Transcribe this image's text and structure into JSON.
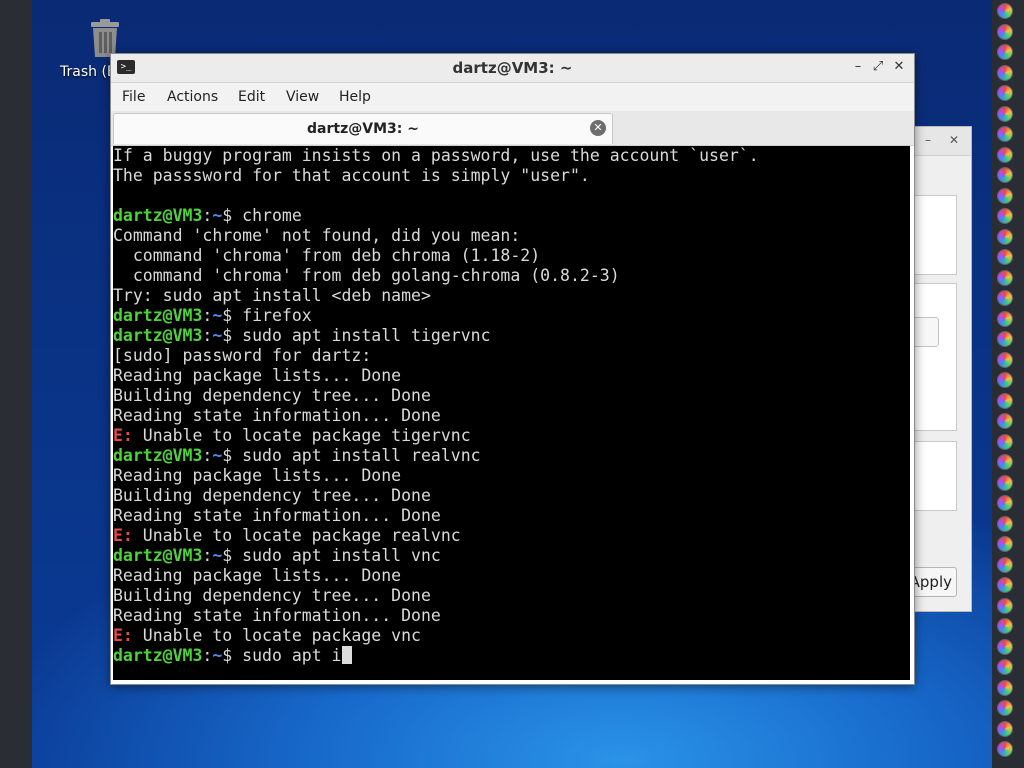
{
  "desktop": {
    "trash_label": "Trash (E"
  },
  "back_window": {
    "apply_label": "Apply"
  },
  "terminal_window": {
    "title": "dartz@VM3: ~",
    "menu": [
      "File",
      "Actions",
      "Edit",
      "View",
      "Help"
    ],
    "tab_label": "dartz@VM3: ~",
    "prompt_user": "dartz@VM3",
    "prompt_sep": ":",
    "prompt_path": "~",
    "prompt_symbol": "$ ",
    "lines": [
      {
        "type": "out",
        "text": "If a buggy program insists on a password, use the account `user`."
      },
      {
        "type": "out",
        "text": "The passsword for that account is simply \"user\"."
      },
      {
        "type": "out",
        "text": ""
      },
      {
        "type": "cmd",
        "text": "chrome"
      },
      {
        "type": "out",
        "text": "Command 'chrome' not found, did you mean:"
      },
      {
        "type": "out",
        "text": "  command 'chroma' from deb chroma (1.18-2)"
      },
      {
        "type": "out",
        "text": "  command 'chroma' from deb golang-chroma (0.8.2-3)"
      },
      {
        "type": "out",
        "text": "Try: sudo apt install <deb name>"
      },
      {
        "type": "cmd",
        "text": "firefox"
      },
      {
        "type": "cmd",
        "text": "sudo apt install tigervnc"
      },
      {
        "type": "out",
        "text": "[sudo] password for dartz:"
      },
      {
        "type": "out",
        "text": "Reading package lists... Done"
      },
      {
        "type": "out",
        "text": "Building dependency tree... Done"
      },
      {
        "type": "out",
        "text": "Reading state information... Done"
      },
      {
        "type": "err",
        "label": "E:",
        "text": " Unable to locate package tigervnc"
      },
      {
        "type": "cmd",
        "text": "sudo apt install realvnc"
      },
      {
        "type": "out",
        "text": "Reading package lists... Done"
      },
      {
        "type": "out",
        "text": "Building dependency tree... Done"
      },
      {
        "type": "out",
        "text": "Reading state information... Done"
      },
      {
        "type": "err",
        "label": "E:",
        "text": " Unable to locate package realvnc"
      },
      {
        "type": "cmd",
        "text": "sudo apt install vnc"
      },
      {
        "type": "out",
        "text": "Reading package lists... Done"
      },
      {
        "type": "out",
        "text": "Building dependency tree... Done"
      },
      {
        "type": "out",
        "text": "Reading state information... Done"
      },
      {
        "type": "err",
        "label": "E:",
        "text": " Unable to locate package vnc"
      },
      {
        "type": "input",
        "text": "sudo apt i"
      }
    ]
  },
  "colors": {
    "prompt": "#4fd33b",
    "path": "#4b8ef5",
    "error": "#e24a4a",
    "terminal_bg": "#000000",
    "terminal_fg": "#dadada"
  }
}
